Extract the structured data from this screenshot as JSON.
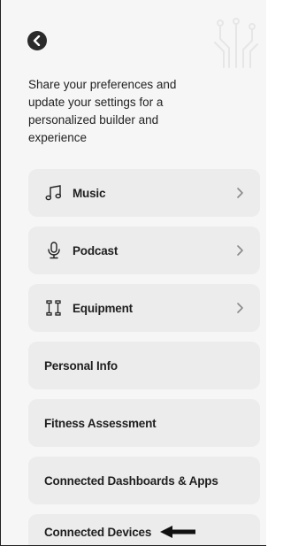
{
  "header": {
    "back_icon": "chevron-left-icon",
    "decoration_icon": "circuit-decoration-icon"
  },
  "intro_text": "Share your preferences and update your settings for a personalized builder and experience",
  "settings": [
    {
      "label": "Music",
      "icon": "music-note-icon",
      "has_chevron": true
    },
    {
      "label": "Podcast",
      "icon": "microphone-icon",
      "has_chevron": true
    },
    {
      "label": "Equipment",
      "icon": "dumbbell-icon",
      "has_chevron": true
    },
    {
      "label": "Personal Info",
      "icon": "",
      "has_chevron": false
    },
    {
      "label": "Fitness Assessment",
      "icon": "",
      "has_chevron": false
    },
    {
      "label": "Connected Dashboards & Apps",
      "icon": "",
      "has_chevron": false
    },
    {
      "label": "Connected Devices",
      "icon": "",
      "has_chevron": false
    }
  ],
  "annotation": {
    "icon": "left-arrow-icon",
    "target": "Connected Devices"
  },
  "colors": {
    "background": "#f6f6f6",
    "row_background": "#ececec",
    "text": "#1f1f1f",
    "back_button": "#2b2b2b"
  }
}
